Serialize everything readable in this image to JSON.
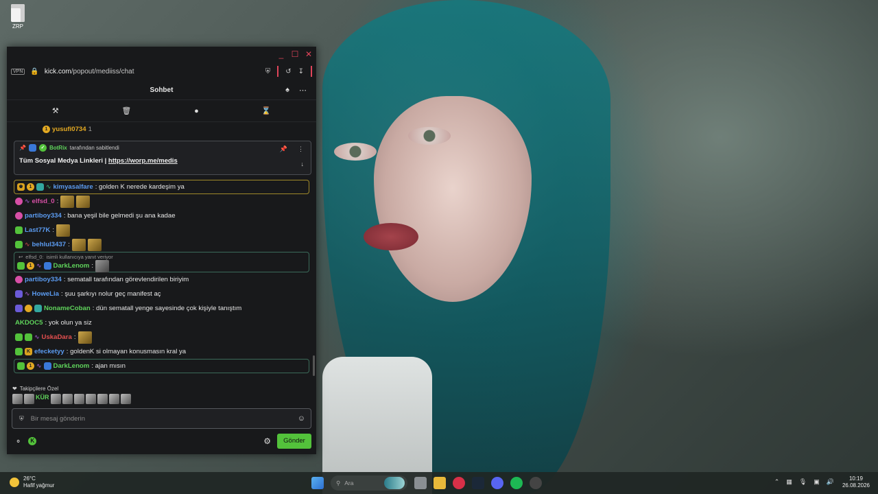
{
  "desktop": {
    "icon_label": "ZRP"
  },
  "window": {
    "controls": {
      "minimize": "_",
      "maximize": "☐",
      "close": "✕"
    },
    "address": {
      "vpn_label": "VPN",
      "url_domain": "kick.com",
      "url_path": "/popout/mediiss/chat"
    }
  },
  "chat": {
    "header_title": "Sohbet",
    "top_cut_user": "yusufi0734",
    "top_cut_count": "1",
    "pinned": {
      "bot_name": "BotRix",
      "pinned_by_text": "tarafından sabitlendi",
      "message_text": "Tüm Sosyal Medya Linkleri |",
      "link": "https://worp.me/medis"
    },
    "messages": [
      {
        "user": "kimyasalfare",
        "text": "golden K nerede kardeşim ya",
        "color": "#5b9bf0"
      },
      {
        "user": "elfsd_0",
        "text": "",
        "color": "#d74fa6"
      },
      {
        "user": "partiboy334",
        "text": "bana yeşil bile gelmedi şu ana kadae",
        "color": "#5b9bf0"
      },
      {
        "user": "Last77K",
        "text": "",
        "color": "#5b9bf0"
      },
      {
        "user": "behlul3437",
        "text": "",
        "color": "#5b9bf0"
      },
      {
        "user": "DarkLenom",
        "text": "",
        "color": "#5fd35b"
      },
      {
        "user": "partiboy334",
        "text": "sematall tarafından görevlendirilen biriyim",
        "color": "#5b9bf0"
      },
      {
        "user": "HoweLia",
        "text": "şuu şarkıyı nolur geç manifest aç",
        "color": "#5b9bf0"
      },
      {
        "user": "NonameCoban",
        "text": "dün sematall yenge sayesinde çok kişiyle tanıştım",
        "color": "#5fd35b"
      },
      {
        "user": "AKDOC5",
        "text": "yok olun ya siz",
        "color": "#5fd35b"
      },
      {
        "user": "UskaDara",
        "text": "",
        "color": "#e44f4f"
      },
      {
        "user": "efecketyy",
        "text": "goldenK si olmayan konusmasın kral ya",
        "color": "#5b9bf0"
      },
      {
        "user": "DarkLenom",
        "text": "ajan mısın",
        "color": "#5fd35b"
      }
    ],
    "reply_ref": {
      "user": "elfsd_0:",
      "note": "isimli kullanıcıya yanıt veriyor"
    },
    "followers_label": "Takipçilere Özel",
    "follower_emote_text": "KÜR",
    "input_placeholder": "Bir mesaj gönderin",
    "send_label": "Gönder"
  },
  "taskbar": {
    "temp": "26°C",
    "weather": "Hafif yağmur",
    "search_placeholder": "Ara",
    "time": "10:19",
    "date": "26.08.2026"
  }
}
